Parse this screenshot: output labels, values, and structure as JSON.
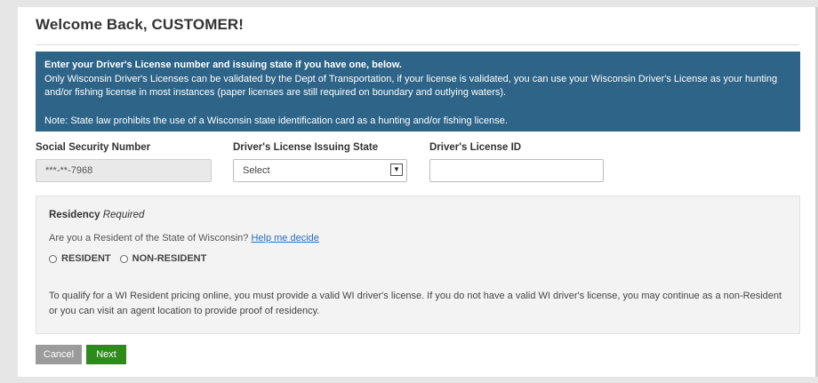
{
  "page": {
    "title": "Welcome Back, CUSTOMER!"
  },
  "info_box": {
    "heading": "Enter your Driver's License number and issuing state if you have one, below.",
    "body": "Only Wisconsin Driver's Licenses can be validated by the Dept of Transportation, if your license is validated, you can use your Wisconsin Driver's License as your hunting and/or fishing license in most instances (paper licenses are still required on boundary and outlying waters).",
    "note": "Note: State law prohibits the use of a Wisconsin state identification card as a hunting and/or fishing license.",
    "background_color": "#2d6488"
  },
  "fields": {
    "ssn_label": "Social Security Number",
    "ssn_value": "***-**-7968",
    "state_label": "Driver's License Issuing State",
    "state_value": "Select",
    "dl_label": "Driver's License ID",
    "dl_value": ""
  },
  "residency": {
    "title": "Residency",
    "required_label": "Required",
    "question": "Are you a Resident of the State of Wisconsin?",
    "help_link": "Help me decide",
    "options": [
      "RESIDENT",
      "NON-RESIDENT"
    ],
    "description": "To qualify for a WI Resident pricing online, you must provide a valid WI driver's license. If you do not have a valid WI driver's license, you may continue as a non-Resident or you can visit an agent location to provide proof of residency."
  },
  "buttons": {
    "cancel_label": "Cancel",
    "next_label": "Next",
    "next_color": "#2f8a1c",
    "cancel_color": "#9b9b9b"
  },
  "icons": {
    "select_arrow": "chevron-down-icon"
  }
}
